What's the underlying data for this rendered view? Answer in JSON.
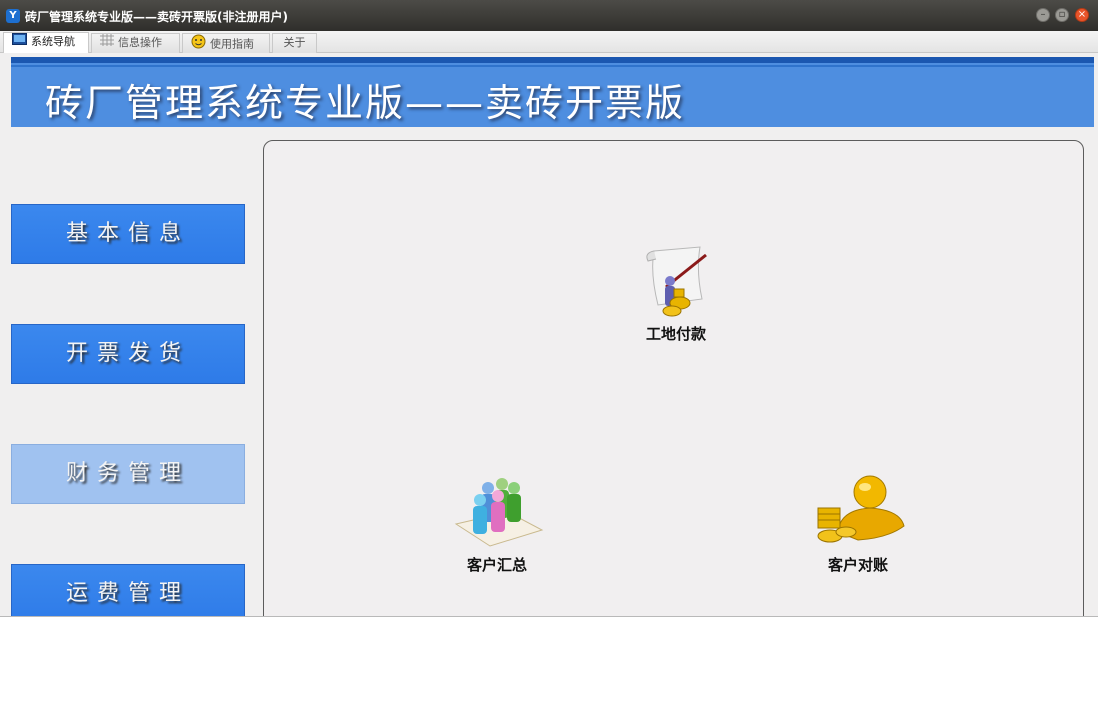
{
  "window": {
    "title": "砖厂管理系统专业版——卖砖开票版(非注册用户)",
    "app_icon_text": "Y"
  },
  "tabs": [
    {
      "label": "系统导航",
      "icon": "monitor-icon",
      "active": true
    },
    {
      "label": "信息操作",
      "icon": "grid-icon",
      "active": false
    },
    {
      "label": "使用指南",
      "icon": "smiley-icon",
      "active": false
    },
    {
      "label": "关于",
      "icon": "",
      "active": false
    }
  ],
  "banner": {
    "title": "砖厂管理系统专业版——卖砖开票版",
    "color": "#4e8ee0"
  },
  "nav": {
    "items": [
      {
        "label": "基本信息",
        "selected": false
      },
      {
        "label": "开票发货",
        "selected": false
      },
      {
        "label": "财务管理",
        "selected": true
      },
      {
        "label": "运费管理",
        "selected": false
      }
    ]
  },
  "panel": {
    "items": [
      {
        "label": "工地付款",
        "icon": "payment-scroll-icon"
      },
      {
        "label": "客户汇总",
        "icon": "customer-group-icon"
      },
      {
        "label": "客户对账",
        "icon": "gold-coins-icon"
      }
    ]
  },
  "colors": {
    "nav_button": "#2e7be8",
    "nav_button_selected": "#a0c2f0",
    "close_button": "#e8542a"
  }
}
